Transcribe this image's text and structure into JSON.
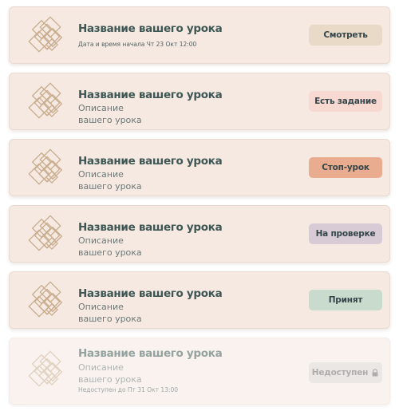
{
  "lessons": [
    {
      "title": "Название вашего урока",
      "meta": "Дата и время начала Чт 23 Окт 12:00",
      "button": "Смотреть",
      "button_color": "#e8dac6"
    },
    {
      "title": "Название вашего урока",
      "description": "Описание вашего урока",
      "button": "Есть задание",
      "button_color": "#f8d9d2"
    },
    {
      "title": "Название вашего урока",
      "description": "Описание вашего урока",
      "button": "Стоп-урок",
      "button_color": "#eaac8e"
    },
    {
      "title": "Название вашего урока",
      "description": "Описание вашего урока",
      "button": "На проверке",
      "button_color": "#d8cbd6"
    },
    {
      "title": "Название вашего урока",
      "description": "Описание вашего урока",
      "button": "Принят",
      "button_color": "#c9dbcc"
    },
    {
      "title": "Название вашего урока",
      "description": "Описание вашего урока",
      "meta": "Недоступен до Пт 31 Окт 13:00",
      "button": "Недоступен",
      "button_icon": "lock-icon",
      "button_color": "#d9d4d1"
    }
  ],
  "colors": {
    "card_background": "#f5e9e2",
    "title_text": "#3e5754",
    "logo_stroke": "#c9ad8e"
  }
}
